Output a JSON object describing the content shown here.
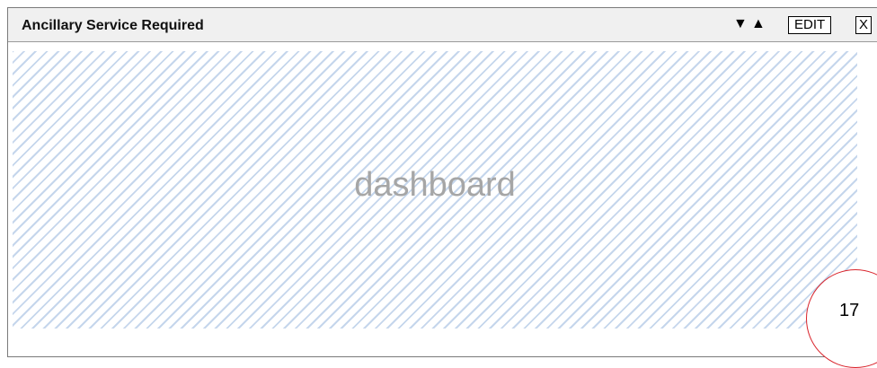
{
  "panel": {
    "title": "Ancillary Service Required",
    "controls": {
      "move_down_icon": "▼",
      "move_up_icon": "▲",
      "edit_label": "EDIT",
      "close_label": "X"
    },
    "placeholder_text": "dashboard",
    "badge_number": "17"
  },
  "colors": {
    "header_bg": "#f0f0f0",
    "hatch": "#c5d6ec",
    "badge_border": "#d9242c",
    "watermark": "#a6a6a6"
  }
}
